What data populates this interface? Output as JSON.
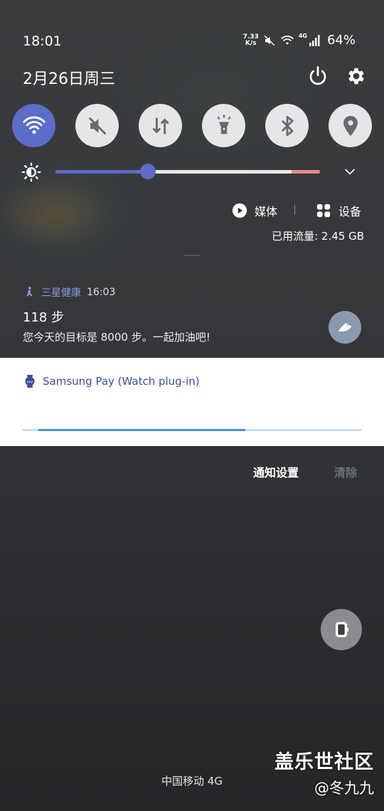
{
  "status_bar": {
    "time": "18:01",
    "net_speed_value": "7.33",
    "net_speed_unit": "K/s",
    "network_type": "4G",
    "battery": "64%",
    "icons": [
      "mute-icon",
      "wifi-icon",
      "signal-icon"
    ]
  },
  "header": {
    "date": "2月26日周三",
    "icons": [
      "power-icon",
      "settings-gear-icon"
    ]
  },
  "quick_tiles": [
    {
      "name": "wifi",
      "icon": "wifi-icon",
      "active": true
    },
    {
      "name": "sound",
      "icon": "mute-icon",
      "active": false
    },
    {
      "name": "mobile-data",
      "icon": "data-arrows-icon",
      "active": false
    },
    {
      "name": "flashlight",
      "icon": "flashlight-icon",
      "active": false
    },
    {
      "name": "bluetooth",
      "icon": "bluetooth-icon",
      "active": false
    },
    {
      "name": "location",
      "icon": "location-pin-icon",
      "active": false
    }
  ],
  "brightness": {
    "level": 0.35
  },
  "media": {
    "media_label": "媒体",
    "devices_label": "设备"
  },
  "data_usage": "已用流量: 2.45 GB",
  "notifications": {
    "health": {
      "app_name": "三星健康",
      "time": "16:03",
      "title": "118 步",
      "body": "您今天的目标是 8000 步。一起加油吧!"
    },
    "pay": {
      "app_name": "Samsung Pay (Watch plug-in)",
      "progress": 0.64
    }
  },
  "actions": {
    "settings_label": "通知设置",
    "clear_label": "清除"
  },
  "carrier": "中国移动 4G",
  "watermark": {
    "line1": "盖乐世社区",
    "line2": "@冬九九"
  },
  "colors": {
    "accent": "#5c6cc7",
    "tile_off": "#e6e6e8",
    "pay_text": "#3e4d99",
    "progress": "#4a8fdc"
  }
}
